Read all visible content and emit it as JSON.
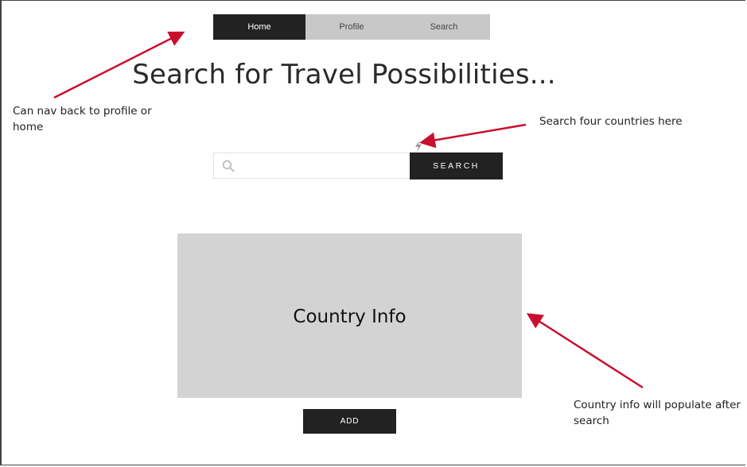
{
  "nav": {
    "items": [
      {
        "label": "Home",
        "active": true
      },
      {
        "label": "Profile",
        "active": false
      },
      {
        "label": "Search",
        "active": false
      }
    ]
  },
  "page": {
    "title": "Search for Travel Possibilities..."
  },
  "search": {
    "value": "",
    "placeholder": "",
    "button_label": "SEARCH"
  },
  "country_info": {
    "title": "Country Info",
    "add_label": "ADD"
  },
  "annotations": {
    "nav_note": "Can nav back to profile or home",
    "search_note": "Search four countries here",
    "info_note": "Country info will populate after search"
  },
  "colors": {
    "dark": "#222222",
    "nav_bg": "#c8c8c8",
    "panel_bg": "#d3d3d3",
    "annotation_arrow": "#c8102e"
  }
}
